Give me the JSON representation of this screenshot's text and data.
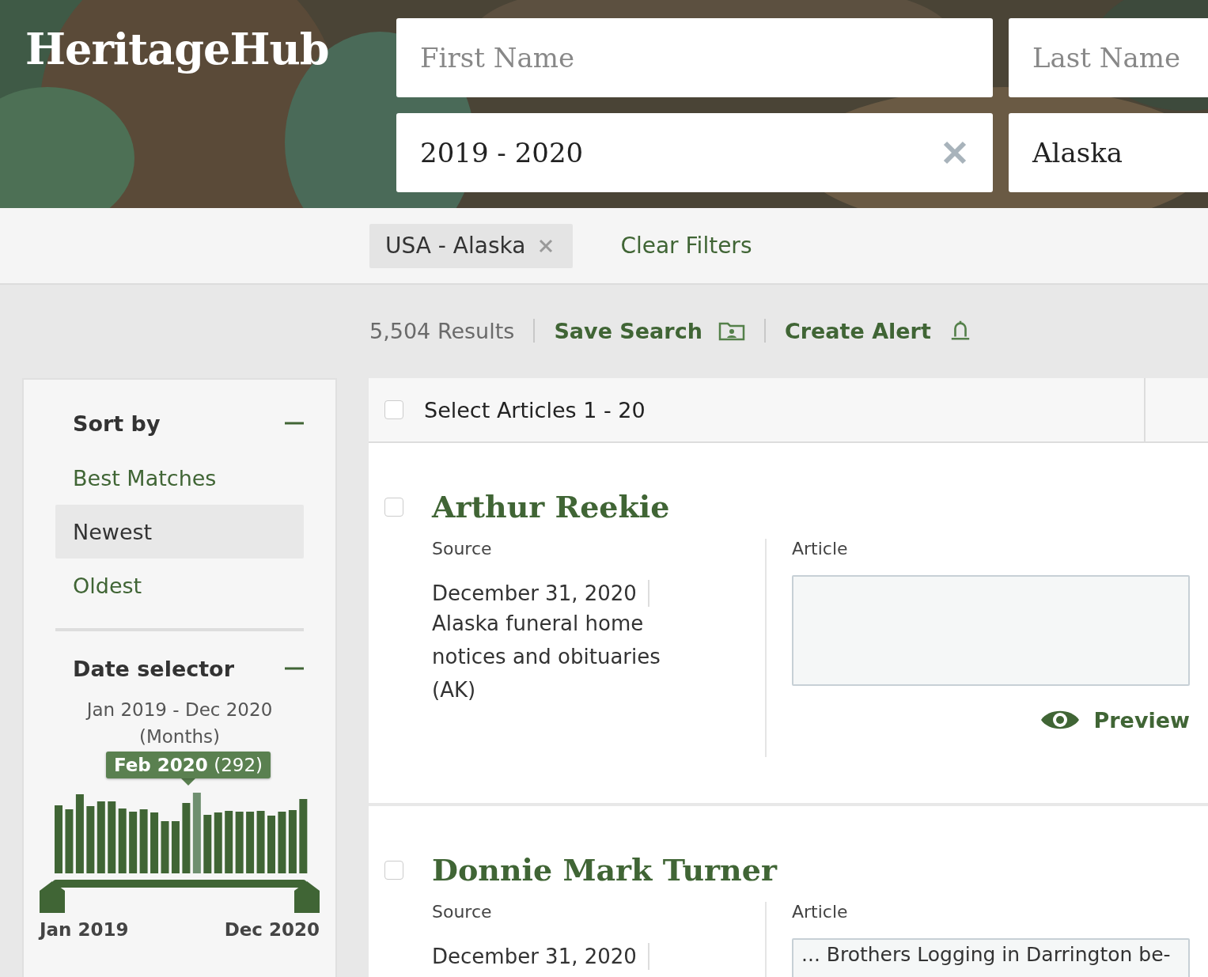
{
  "brand": "HeritageHub",
  "search": {
    "fields": [
      {
        "placeholder": "First Name"
      },
      {
        "placeholder": "Last Name"
      },
      {
        "value": "2019 - 2020",
        "clearable": true
      },
      {
        "value": "Alaska",
        "clearable": false
      }
    ]
  },
  "filters": {
    "chips": [
      {
        "label": "USA - Alaska"
      }
    ],
    "clear_label": "Clear Filters"
  },
  "results_bar": {
    "count": "5,504 Results",
    "actions": [
      {
        "label": "Save Search",
        "kind": "folder"
      },
      {
        "label": "Create Alert",
        "kind": "bell"
      }
    ]
  },
  "sidebar": {
    "sort": {
      "title": "Sort by",
      "expanded": true,
      "options": [
        {
          "label": "Best Matches",
          "selected": false
        },
        {
          "label": "Newest",
          "selected": true
        },
        {
          "label": "Oldest",
          "selected": false
        }
      ]
    },
    "date": {
      "title": "Date selector",
      "expanded": true,
      "range": "Jan 2019 - Dec 2020",
      "unit": "(Months)",
      "tooltip_label": "Feb 2020",
      "tooltip_count": "(292)",
      "start_label": "Jan 2019",
      "end_label": "Dec 2020"
    }
  },
  "list": {
    "select_all": {
      "label": "Select Articles 1 - 20",
      "checked": false
    },
    "results": [
      {
        "name": "Arthur Reekie",
        "checked": false,
        "source_label": "Source",
        "date": "December 31, 2020",
        "source": "Alaska funeral home notices and obituaries (AK)",
        "article_label": "Article",
        "action": "Preview"
      },
      {
        "name": "Donnie Mark Turner",
        "checked": false,
        "source_label": "Source",
        "date": "December 31, 2020",
        "article_label": "Article",
        "excerpt": "... Brothers Logging in Darrington be-"
      }
    ]
  }
}
